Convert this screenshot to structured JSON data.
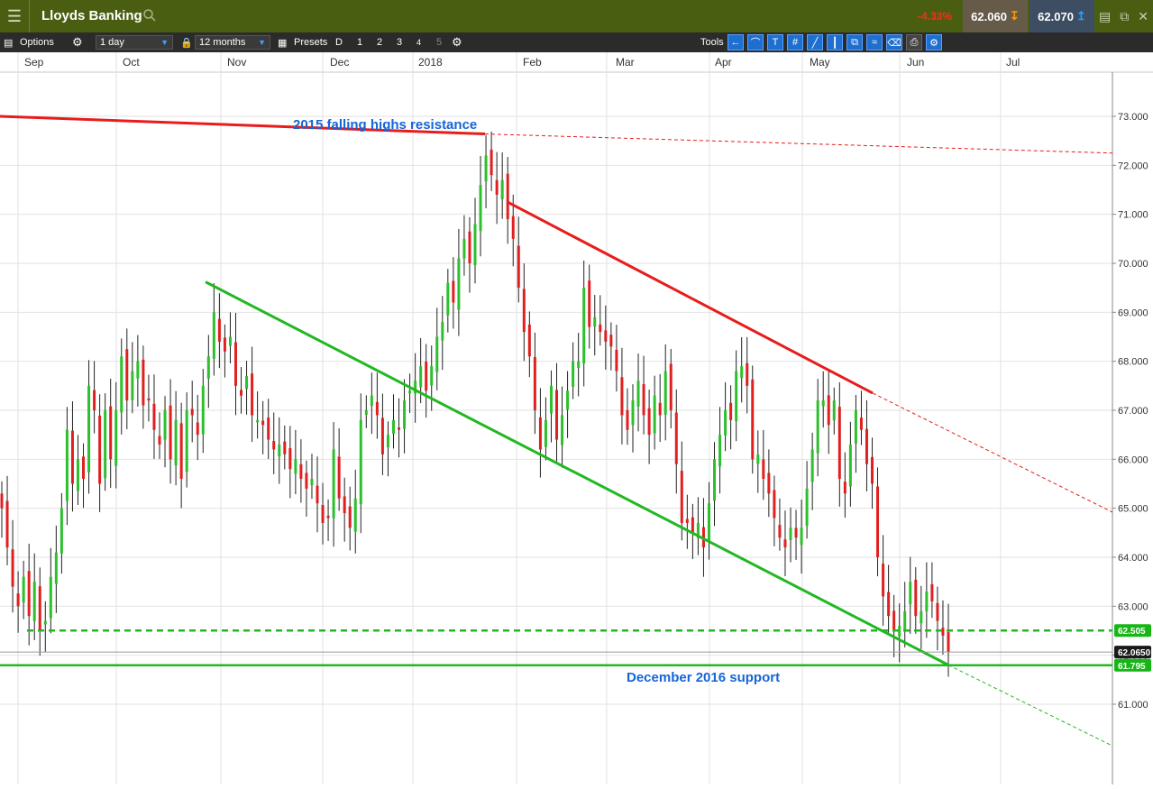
{
  "app": {
    "title": "Lloyds Banking",
    "change_pct": "-4.33%",
    "sell_price": "62.060",
    "buy_price": "62.070"
  },
  "toolbar": {
    "options_label": "Options",
    "interval": "1 day",
    "range": "12 months",
    "presets_label": "Presets",
    "preset_buttons": [
      "D",
      "1",
      "2",
      "3",
      "4",
      "5"
    ],
    "tools_label": "Tools"
  },
  "colors": {
    "resistance": "#e81c1c",
    "support": "#22b822",
    "annotation": "#1565d8",
    "up_candle": "#2cc02c",
    "down_candle": "#e02020",
    "label_bg": "#16b616"
  },
  "chart_data": {
    "type": "candlestick",
    "instrument": "Lloyds Banking",
    "interval": "1 day",
    "x_axis_labels": [
      "Sep",
      "Oct",
      "Nov",
      "Dec",
      "2018",
      "Feb",
      "Mar",
      "Apr",
      "May",
      "Jun",
      "Jul"
    ],
    "y_ticks": [
      "61.000",
      "62.000",
      "63.000",
      "64.000",
      "65.000",
      "66.000",
      "67.000",
      "68.000",
      "69.000",
      "70.000",
      "71.000",
      "72.000",
      "73.000"
    ],
    "ylim": [
      60.1,
      73.9
    ],
    "grid": true,
    "annotations": [
      "2015 falling highs resistance",
      "December 2016 support"
    ],
    "price_labels": {
      "upper_support": "62.505",
      "current": "62.0650",
      "lower_support": "61.795"
    },
    "trendlines": [
      {
        "color": "red",
        "from": [
          "2017-08",
          73.0
        ],
        "to": [
          "2018-01-15",
          72.6
        ],
        "extended_to": [
          "2018-07-31",
          72.3
        ],
        "label": "2015 falling highs resistance"
      },
      {
        "color": "red",
        "from": [
          "2018-01-23",
          71.3
        ],
        "to": [
          "2018-05-25",
          67.3
        ],
        "extended_to": [
          "2018-07-31",
          64.9
        ]
      },
      {
        "color": "green",
        "from": [
          "2017-10-27",
          69.6
        ],
        "to": [
          "2018-06-15",
          61.8
        ],
        "extended_to": [
          "2018-07-31",
          60.2
        ]
      },
      {
        "color": "green",
        "type": "horizontal",
        "value": 61.795,
        "label": "December 2016 support"
      },
      {
        "color": "green",
        "type": "horizontal_dashed",
        "value": 62.505
      }
    ],
    "series": [
      {
        "name": "Lloyds Banking",
        "close": [
          65.0,
          64.2,
          63.4,
          63.0,
          63.6,
          62.8,
          63.5,
          62.5,
          62.7,
          63.6,
          64.1,
          65.0,
          66.6,
          65.5,
          66.0,
          65.6,
          67.5,
          67.0,
          65.5,
          67.0,
          66.0,
          67.0,
          68.1,
          67.2,
          67.8,
          68.0,
          67.1,
          67.2,
          66.6,
          66.3,
          67.0,
          66.0,
          66.8,
          65.6,
          67.0,
          66.9,
          66.5,
          67.5,
          68.1,
          69.0,
          68.4,
          68.2,
          68.5,
          67.5,
          67.3,
          67.7,
          66.9,
          66.8,
          66.7,
          66.4,
          66.2,
          66.3,
          66.1,
          65.8,
          66.0,
          65.6,
          65.4,
          65.6,
          65.1,
          64.7,
          64.8,
          66.2,
          65.2,
          64.9,
          64.6,
          65.2,
          66.8,
          67.0,
          67.3,
          66.9,
          66.1,
          66.5,
          66.8,
          66.6,
          67.2,
          67.4,
          67.6,
          67.9,
          67.4,
          67.9,
          68.5,
          68.8,
          69.6,
          69.2,
          70.1,
          70.5,
          70.0,
          70.8,
          71.6,
          72.2,
          71.8,
          71.4,
          71.7,
          70.9,
          70.5,
          69.5,
          68.6,
          68.1,
          67.0,
          66.2,
          66.8,
          67.5,
          66.4,
          66.9,
          67.4,
          68.0,
          68.0,
          69.5,
          68.7,
          68.9,
          68.6,
          68.4,
          68.3,
          67.8,
          66.9,
          66.6,
          67.2,
          67.6,
          66.9,
          66.5,
          67.3,
          66.9,
          67.8,
          67.0,
          65.9,
          64.7,
          64.7,
          64.5,
          64.7,
          64.2,
          65.1,
          66.0,
          66.5,
          67.0,
          66.8,
          67.8,
          67.9,
          67.5,
          66.0,
          66.1,
          65.6,
          65.3,
          64.8,
          64.4,
          64.2,
          64.6,
          64.4,
          64.6,
          65.4,
          66.2,
          67.2,
          67.2,
          66.7,
          67.2,
          65.6,
          65.3,
          66.3,
          67.0,
          66.6,
          65.9,
          65.5,
          64.0,
          63.2,
          62.8,
          62.5,
          62.6,
          62.9,
          63.5,
          62.8,
          62.9,
          63.3,
          63.1,
          62.7,
          62.4,
          62.07
        ]
      }
    ]
  }
}
